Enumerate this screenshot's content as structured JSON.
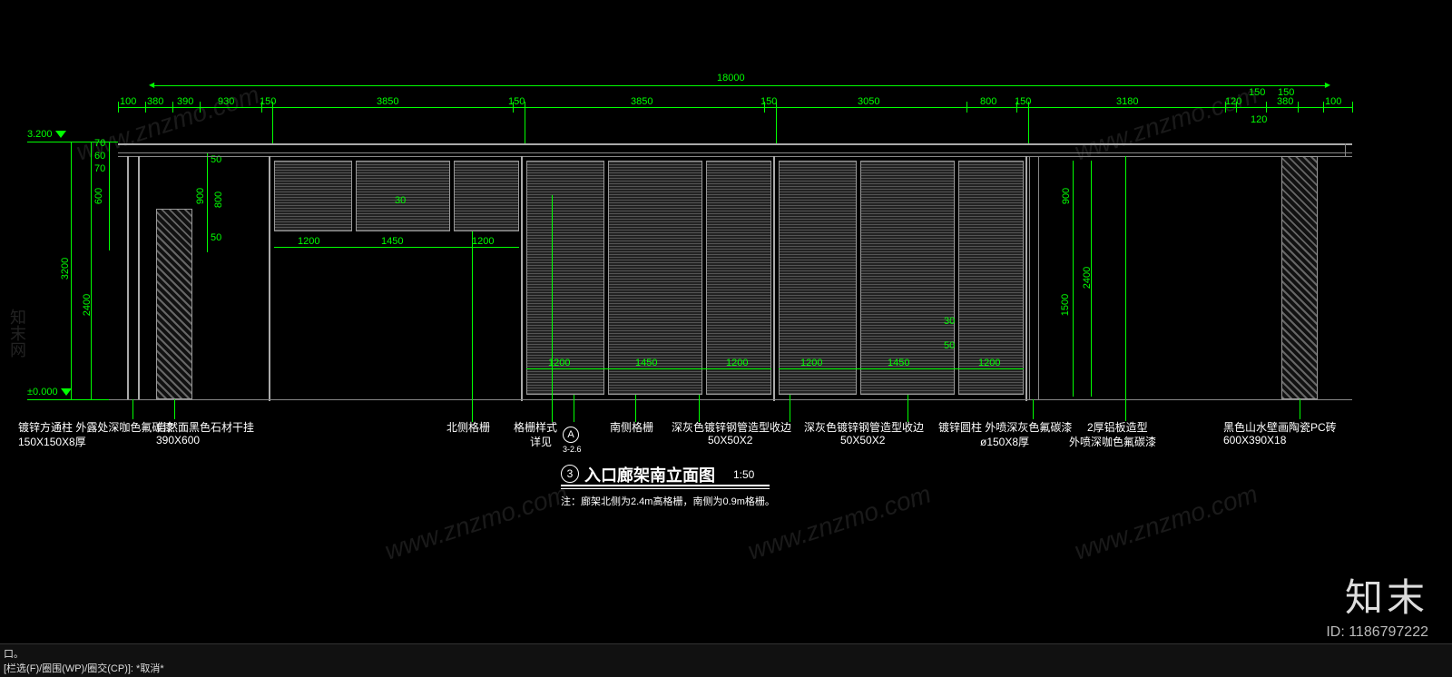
{
  "drawing": {
    "title_number": "3",
    "title_text": "入口廊架南立面图",
    "scale": "1:50",
    "note": "注：廊架北侧为2.4m高格栅，南侧为0.9m格栅。",
    "a_label": "A",
    "a_ref": "3-2.6",
    "a_desc_top": "格栅样式",
    "a_desc_bottom": "详见"
  },
  "levels": {
    "top": "3.200",
    "bottom": "±0.000"
  },
  "top_dims": {
    "overall": "18000",
    "left_out_1": "100",
    "left_out_2": "380",
    "left_out_3": "390",
    "seg1": "930",
    "seg2": "150",
    "seg3": "3850",
    "seg4": "150",
    "seg5": "3850",
    "seg6": "150",
    "seg7": "3050",
    "seg8": "800",
    "seg9": "150",
    "seg10": "3180",
    "r1": "120",
    "r2": "150",
    "r3": "380",
    "r4": "100",
    "r5": "120",
    "r6": "150"
  },
  "left_dims": {
    "v1": "70",
    "v2": "60",
    "v3": "70",
    "v4": "600",
    "v5": "2400",
    "v6": "3200",
    "v7": "900",
    "v8": "800",
    "v9": "50",
    "v10": "50"
  },
  "right_dims": {
    "v1": "900",
    "v2": "1500",
    "v3": "2400"
  },
  "mid_dims": {
    "t30": "30",
    "t50": "50",
    "row_a1": "1200",
    "row_a2": "1450",
    "row_a3": "1200",
    "row_b1": "1200",
    "row_b2": "1450",
    "row_b3": "1200",
    "row_c1": "1200",
    "row_c2": "1450",
    "row_c3": "1200"
  },
  "labels": {
    "l1a": "镀锌方通柱  外露处深咖色氟碳漆",
    "l1b": "150X150X8厚",
    "l2a": "自然面黑色石材干挂",
    "l2b": "390X600",
    "l3": "北侧格栅",
    "l4": "南侧格栅",
    "l5a": "深灰色镀锌钢管造型收边",
    "l5b": "50X50X2",
    "l6a": "深灰色镀锌钢管造型收边",
    "l6b": "50X50X2",
    "l7a": "镀锌圆柱  外喷深灰色氟碳漆",
    "l7b": "ø150X8厚",
    "l8a": "2厚铝板造型",
    "l8b": "外喷深咖色氟碳漆",
    "l9a": "黑色山水壁画陶瓷PC砖",
    "l9b": "600X390X18"
  },
  "footer": {
    "line1": "口。",
    "line2": "[栏选(F)/圈围(WP)/圈交(CP)]: *取消*"
  },
  "watermark": {
    "brand_cn": "知末",
    "brand_en": "www.znzmo.com",
    "id_label": "ID: 1186797222",
    "brand_side": "知末网"
  }
}
